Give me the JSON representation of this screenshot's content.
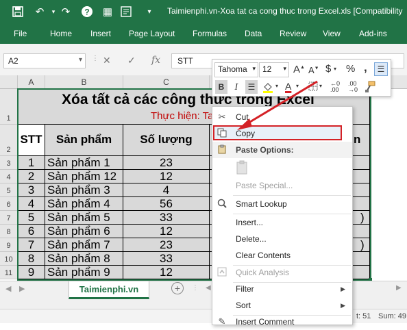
{
  "title_bar": {
    "title": "Taimienphi.vn-Xoa tat ca cong thuc trong Excel.xls  [Compatibility"
  },
  "ribbon_tabs": [
    "File",
    "Home",
    "Insert",
    "Page Layout",
    "Formulas",
    "Data",
    "Review",
    "View",
    "Add-ins"
  ],
  "formula_bar": {
    "name_box": "A2",
    "fx_label": "fx",
    "content": "STT"
  },
  "columns": [
    "A",
    "B",
    "C"
  ],
  "rows": [
    "1",
    "2",
    "3",
    "4",
    "5",
    "6",
    "7",
    "8",
    "9",
    "10",
    "11"
  ],
  "sheet": {
    "title": "Xóa tất cả các công thức trong Excel",
    "subtitle": "Thực hiện: Taim",
    "headers": [
      "STT",
      "Sản phẩm",
      "Số lượng"
    ],
    "data": [
      [
        "1",
        "Sản phẩm 1",
        "23"
      ],
      [
        "2",
        "Sản phẩm 12",
        "12"
      ],
      [
        "3",
        "Sản phẩm 3",
        "4"
      ],
      [
        "4",
        "Sản phẩm 4",
        "56"
      ],
      [
        "5",
        "Sản phẩm 5",
        "33"
      ],
      [
        "6",
        "Sản phẩm 6",
        "12"
      ],
      [
        "7",
        "Sản phẩm 7",
        "23"
      ],
      [
        "8",
        "Sản phẩm 8",
        "33"
      ],
      [
        "9",
        "Sản phẩm 9",
        "12"
      ]
    ],
    "peek_right": {
      "row2": "n",
      "row7": ")",
      "row9": ")"
    }
  },
  "mini_toolbar": {
    "font_name": "Tahoma",
    "font_size": "12",
    "currency": "$",
    "percent": "%",
    "comma": ","
  },
  "context_menu": {
    "items": [
      {
        "label": "Cut",
        "icon": "scissors-icon",
        "enabled": true
      },
      {
        "label": "Copy",
        "icon": "copy-icon",
        "enabled": true,
        "highlighted": true
      },
      {
        "label": "Paste Options:",
        "icon": "paste-icon",
        "header": true
      },
      {
        "label": "Paste Special...",
        "enabled": false
      },
      {
        "label": "Smart Lookup",
        "icon": "search-icon",
        "enabled": true
      },
      {
        "label": "Insert...",
        "enabled": true
      },
      {
        "label": "Delete...",
        "enabled": true
      },
      {
        "label": "Clear Contents",
        "enabled": true
      },
      {
        "label": "Quick Analysis",
        "icon": "quick-analysis-icon",
        "enabled": false
      },
      {
        "label": "Filter",
        "enabled": true,
        "submenu": true
      },
      {
        "label": "Sort",
        "enabled": true,
        "submenu": true
      },
      {
        "label": "Insert Comment",
        "enabled": true
      }
    ]
  },
  "sheet_tabs": {
    "active": "Taimienphi.vn",
    "add_label": "+"
  },
  "status_bar": {
    "count": "t: 51",
    "sum": "Sum: 49"
  },
  "colors": {
    "excel_green": "#217346",
    "title_red": "#c00000",
    "highlight_red": "#d42126"
  }
}
